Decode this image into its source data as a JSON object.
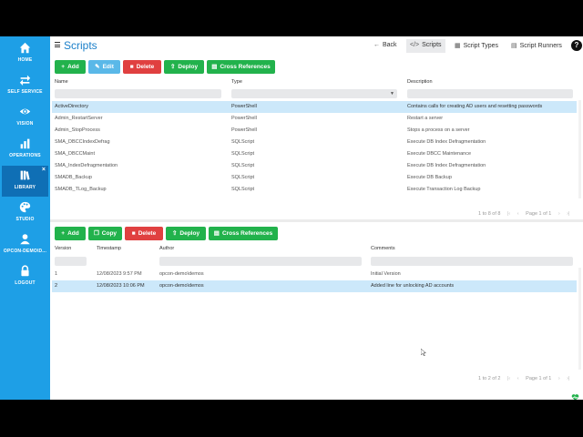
{
  "sidebar": {
    "items": [
      {
        "label": "HOME",
        "icon": "home-icon"
      },
      {
        "label": "SELF SERVICE",
        "icon": "swap-icon"
      },
      {
        "label": "VISION",
        "icon": "eye-icon"
      },
      {
        "label": "OPERATIONS",
        "icon": "operations-icon"
      },
      {
        "label": "LIBRARY",
        "icon": "library-icon",
        "active": true,
        "close": "×"
      },
      {
        "label": "STUDIO",
        "icon": "palette-icon"
      },
      {
        "label": "OPCON-DEMO\\D...",
        "icon": "user-icon"
      },
      {
        "label": "LOGOUT",
        "icon": "lock-icon"
      }
    ]
  },
  "header": {
    "menu_icon": "hamburger-icon",
    "title": "Scripts",
    "links": {
      "back": "Back",
      "scripts": "Scripts",
      "script_types": "Script Types",
      "script_runners": "Script Runners"
    },
    "help": "?"
  },
  "scripts_toolbar": {
    "add": "Add",
    "edit": "Edit",
    "delete": "Delete",
    "deploy": "Deploy",
    "cross_refs": "Cross References"
  },
  "scripts_table": {
    "columns": {
      "name": "Name",
      "type": "Type",
      "description": "Description"
    },
    "rows": [
      {
        "name": "ActiveDirectory",
        "type": "PowerShell",
        "description": "Contains calls for creating AD users and resetting passwords"
      },
      {
        "name": "Admin_RestartServer",
        "type": "PowerShell",
        "description": "Restart a server"
      },
      {
        "name": "Admin_StopProcess",
        "type": "PowerShell",
        "description": "Stops a process on a server"
      },
      {
        "name": "SMA_DBCCIndexDefrag",
        "type": "SQLScript",
        "description": "Execute DB Index Defragmentation"
      },
      {
        "name": "SMA_DBCCMaint",
        "type": "SQLScript",
        "description": "Execute DBCC Maintenance"
      },
      {
        "name": "SMA_IndexDefragmentation",
        "type": "SQLScript",
        "description": "Execute DB Index Defragmentation"
      },
      {
        "name": "SMADB_Backup",
        "type": "SQLScript",
        "description": "Execute DB Backup"
      },
      {
        "name": "SMADB_TLog_Backup",
        "type": "SQLScript",
        "description": "Execute Transaction Log Backup"
      }
    ],
    "pager": {
      "range": "1 to 8 of 8",
      "page": "Page 1 of 1"
    }
  },
  "versions_toolbar": {
    "add": "Add",
    "copy": "Copy",
    "delete": "Delete",
    "deploy": "Deploy",
    "cross_refs": "Cross References"
  },
  "versions_table": {
    "columns": {
      "version": "Version",
      "timestamp": "Timestamp",
      "author": "Author",
      "comments": "Comments"
    },
    "rows": [
      {
        "version": "1",
        "timestamp": "12/08/2023 9:57 PM",
        "author": "opcon-demo\\demos",
        "comments": "Initial Version"
      },
      {
        "version": "2",
        "timestamp": "12/08/2023 10:06 PM",
        "author": "opcon-demo\\demos",
        "comments": "Added line for unlocking AD accounts"
      }
    ],
    "pager": {
      "range": "1 to 2 of 2",
      "page": "Page 1 of 1"
    }
  },
  "colors": {
    "sidebar": "#1e9fe6",
    "accent": "#1a7fc9",
    "green": "#22b24c",
    "red": "#e04040",
    "selected_row": "#cce8fa"
  }
}
